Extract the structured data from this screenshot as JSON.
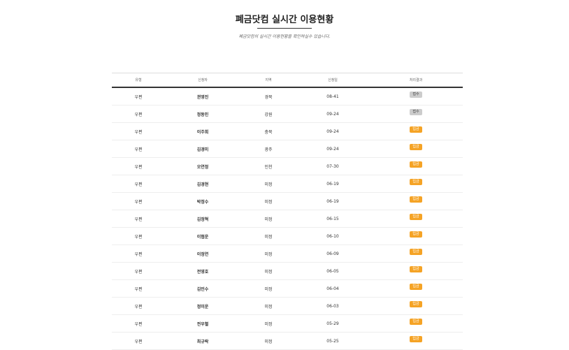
{
  "page": {
    "title": "폐금닷컴 실시간 이용현황",
    "subtitle": "폐금닷컴의 실시간 이용현황을 확인하실수 있습니다."
  },
  "table": {
    "headers": [
      "유형",
      "신청자",
      "지역",
      "신청일",
      "처리결과"
    ],
    "rows": [
      {
        "type": "우편",
        "name": "권영진",
        "region": "경북",
        "date": "08-41",
        "status": "접수",
        "status_style": "gray"
      },
      {
        "type": "우편",
        "name": "정동인",
        "region": "강원",
        "date": "09-24",
        "status": "접수",
        "status_style": "gray"
      },
      {
        "type": "우편",
        "name": "이주희",
        "region": "충북",
        "date": "09-24",
        "status": "입금",
        "status_style": "orange"
      },
      {
        "type": "우편",
        "name": "김경미",
        "region": "광주",
        "date": "09-24",
        "status": "입금",
        "status_style": "orange"
      },
      {
        "type": "우편",
        "name": "오연정",
        "region": "인천",
        "date": "07-30",
        "status": "입금",
        "status_style": "orange"
      },
      {
        "type": "우편",
        "name": "김경현",
        "region": "미정",
        "date": "06-19",
        "status": "입금",
        "status_style": "orange"
      },
      {
        "type": "우편",
        "name": "박정수",
        "region": "미정",
        "date": "06-19",
        "status": "입금",
        "status_style": "orange"
      },
      {
        "type": "우편",
        "name": "김정혁",
        "region": "미정",
        "date": "06-15",
        "status": "입금",
        "status_style": "orange"
      },
      {
        "type": "우편",
        "name": "이협운",
        "region": "미정",
        "date": "06-10",
        "status": "입금",
        "status_style": "orange"
      },
      {
        "type": "우편",
        "name": "이정연",
        "region": "미정",
        "date": "06-09",
        "status": "입금",
        "status_style": "orange"
      },
      {
        "type": "우편",
        "name": "전영호",
        "region": "미정",
        "date": "06-05",
        "status": "입금",
        "status_style": "orange"
      },
      {
        "type": "우편",
        "name": "김민수",
        "region": "미정",
        "date": "06-04",
        "status": "입금",
        "status_style": "orange"
      },
      {
        "type": "우편",
        "name": "정미운",
        "region": "미정",
        "date": "06-03",
        "status": "입금",
        "status_style": "orange"
      },
      {
        "type": "우편",
        "name": "전우혈",
        "region": "미정",
        "date": "05-29",
        "status": "입금",
        "status_style": "orange"
      },
      {
        "type": "우편",
        "name": "최규락",
        "region": "미정",
        "date": "05-25",
        "status": "입금",
        "status_style": "orange"
      }
    ]
  }
}
